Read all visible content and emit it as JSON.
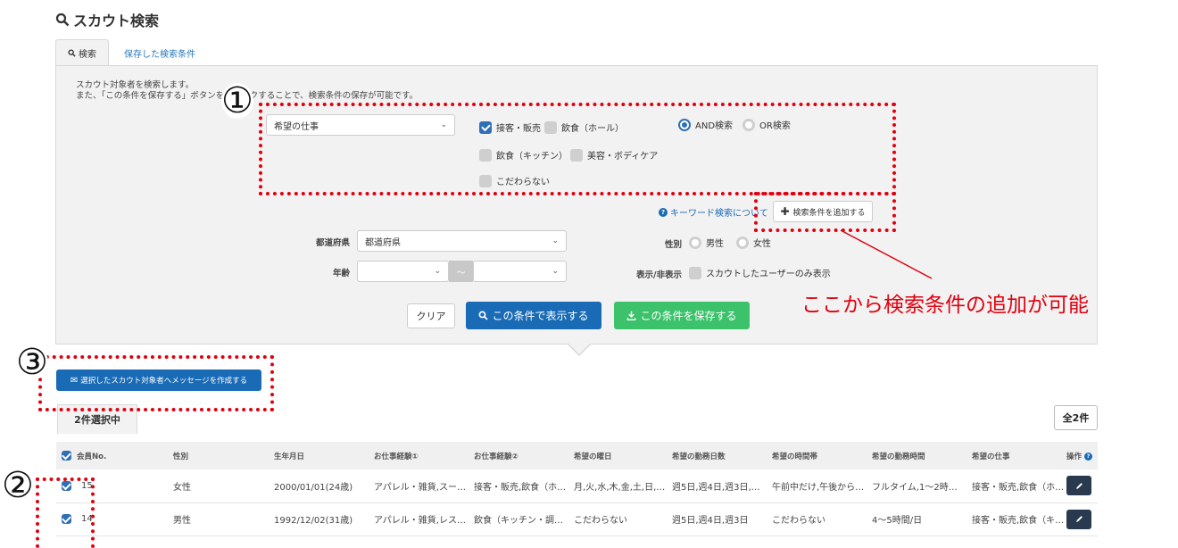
{
  "page": {
    "title": "スカウト検索",
    "tabs": [
      {
        "label": "検索"
      },
      {
        "label": "保存した検索条件"
      }
    ],
    "description": "スカウト対象者を検索します。\nまた、「この条件を保存する」ボタンをクリックすることで、検索条件の保存が可能です。"
  },
  "search": {
    "condition_select": "希望の仕事",
    "checkboxes": [
      {
        "label": "接客・販売",
        "checked": true
      },
      {
        "label": "飲食（ホール）",
        "checked": false
      },
      {
        "label": "飲食（キッチン）",
        "checked": false
      },
      {
        "label": "美容・ボディケア",
        "checked": false
      },
      {
        "label": "こだわらない",
        "checked": false
      }
    ],
    "logic": [
      {
        "label": "AND検索",
        "selected": true
      },
      {
        "label": "OR検索",
        "selected": false
      }
    ],
    "keyword_help": "キーワード検索について",
    "add_condition": "検索条件を追加する",
    "prefecture_label": "都道府県",
    "prefecture_value": "都道府県",
    "age_label": "年齢",
    "age_sep": "〜",
    "gender_label": "性別",
    "gender_options": [
      "男性",
      "女性"
    ],
    "display_label": "表示/非表示",
    "display_option": "スカウトしたユーザーのみ表示",
    "clear_btn": "クリア",
    "show_btn": "この条件で表示する",
    "save_btn": "この条件を保存する"
  },
  "actions": {
    "message_btn": "選択したスカウト対象者へメッセージを作成する",
    "selected_count": "2件選択中",
    "total_count": "全2件"
  },
  "table": {
    "headers": [
      "会員No.",
      "性別",
      "生年月日",
      "お仕事経験①",
      "お仕事経験②",
      "希望の曜日",
      "希望の勤務日数",
      "希望の時間帯",
      "希望の勤務時間",
      "希望の仕事",
      "操作"
    ],
    "rows": [
      [
        "15",
        "女性",
        "2000/01/01(24歳)",
        "アパレル・雑貨,スー…",
        "接客・販売,飲食（ホ…",
        "月,火,水,木,金,土,日,…",
        "週5日,週4日,週3日,…",
        "午前中だけ,午後から…",
        "フルタイム,1〜2時…",
        "接客・販売,飲食（ホ…"
      ],
      [
        "14",
        "男性",
        "1992/12/02(31歳)",
        "アパレル・雑貨,レス…",
        "飲食（キッチン・調…",
        "こだわらない",
        "週5日,週4日,週3日",
        "こだわらない",
        "4〜5時間/日",
        "接客・販売,飲食（キ…"
      ]
    ]
  },
  "annotations": {
    "one": "①",
    "two": "②",
    "three": "③",
    "note": "ここから検索条件の追加が可能"
  },
  "colors": {
    "primary_blue": "#1a6bb5",
    "green": "#3cc26b",
    "annotation_red": "#e0000f"
  }
}
